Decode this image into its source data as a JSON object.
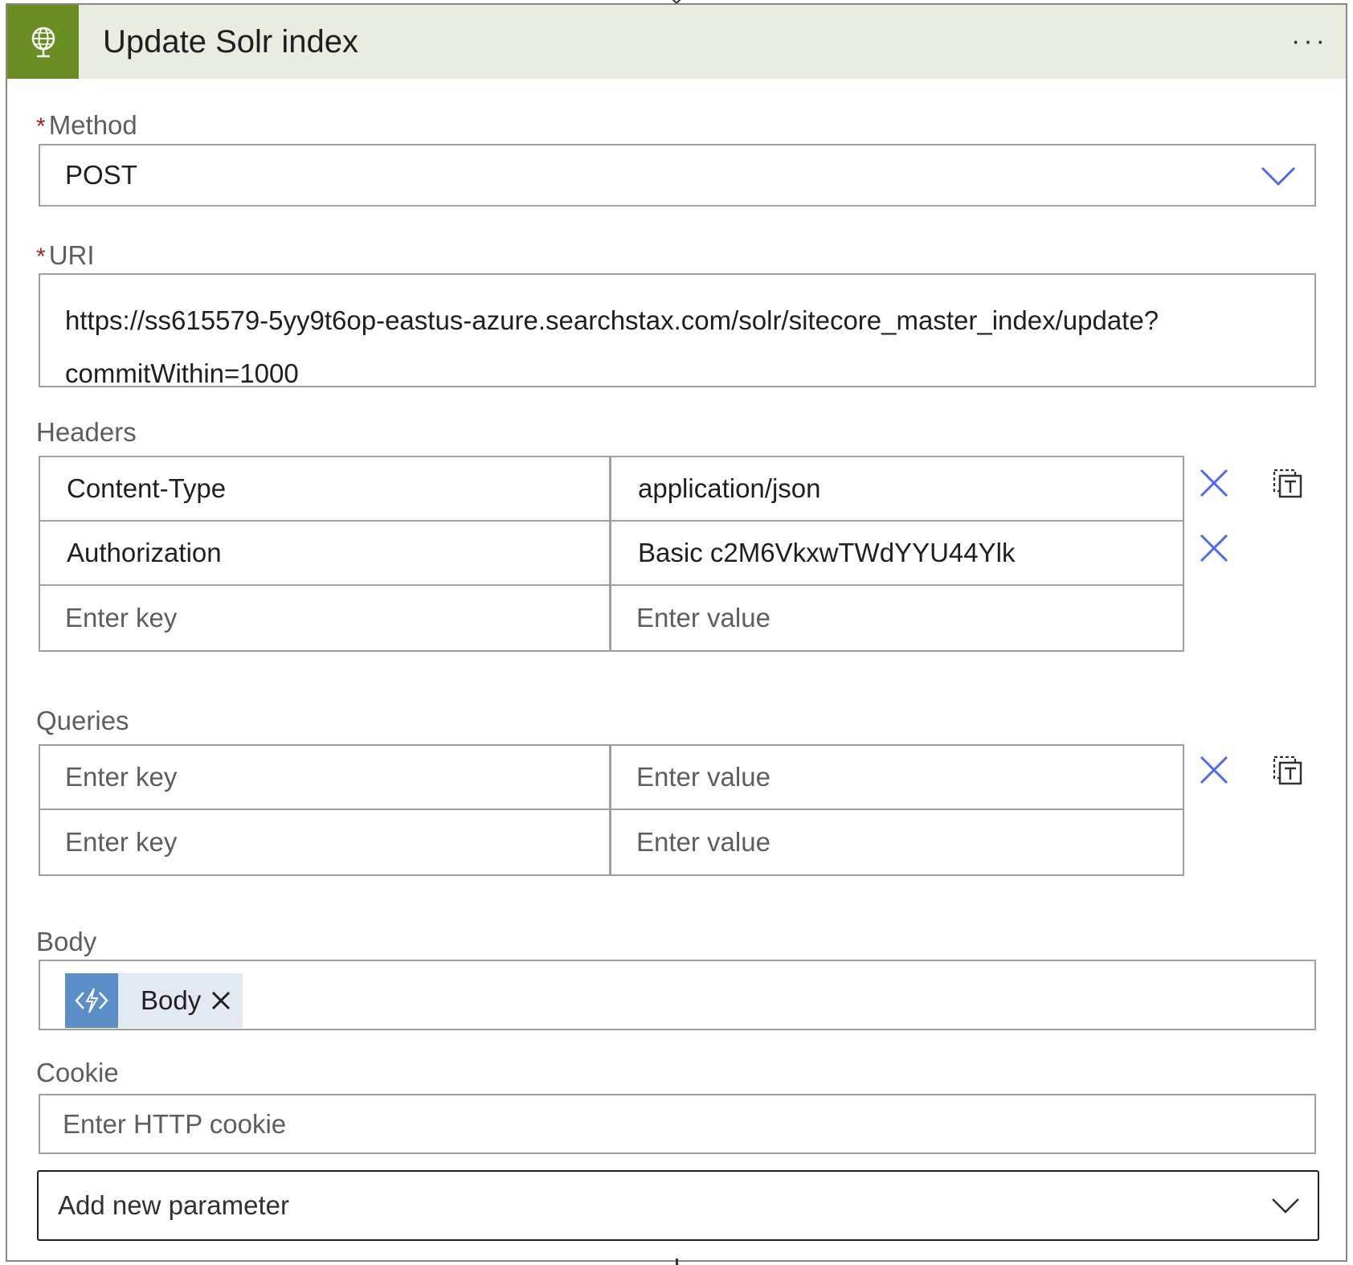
{
  "card": {
    "title": "Update Solr index",
    "more_label": "···",
    "header_icon": "globe-icon",
    "header_color": "#6b8e23"
  },
  "method": {
    "label": "Method",
    "required_mark": "*",
    "value": "POST"
  },
  "uri": {
    "label": "URI",
    "required_mark": "*",
    "line1": "https://ss615579-5yy9t6op-eastus-azure.searchstax.com/solr/sitecore_master_index/update?",
    "line2": "commitWithin=1000"
  },
  "headers": {
    "label": "Headers",
    "rows": [
      {
        "key": "Content-Type",
        "value": "application/json"
      },
      {
        "key": "Authorization",
        "value": "Basic c2M6VkxwTWdYYU44Ylk"
      },
      {
        "key": "Enter key",
        "value": "Enter value"
      }
    ]
  },
  "queries": {
    "label": "Queries",
    "rows": [
      {
        "key": "Enter key",
        "value": "Enter value"
      },
      {
        "key": "Enter key",
        "value": "Enter value"
      }
    ]
  },
  "body": {
    "label": "Body",
    "token_label": "Body",
    "token_color": "#5b8ec9"
  },
  "cookie": {
    "label": "Cookie",
    "placeholder": "Enter HTTP cookie"
  },
  "add_parameter": {
    "label": "Add new parameter"
  },
  "accent_color": "#4f6bed"
}
